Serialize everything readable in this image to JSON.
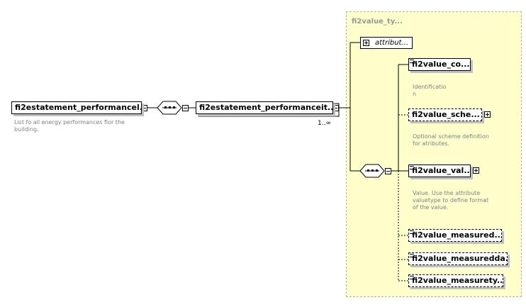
{
  "type_box": {
    "title": "fi2value_ty..."
  },
  "attributes": {
    "label": "attribut..."
  },
  "root": {
    "label": "fi2estatement_performancel...",
    "doc": [
      "List fo all energy performances fior the",
      "building."
    ]
  },
  "child": {
    "label": "fi2estatement_performanceit...",
    "cardinality": "1..∞"
  },
  "elements": [
    {
      "label": "fi2value_co...",
      "doc": [
        "Identificatio",
        "n"
      ]
    },
    {
      "label": "fi2value_sche...",
      "doc": [
        "Optional scheme definition",
        "for atributes."
      ]
    },
    {
      "label": "fi2value_val...",
      "doc": [
        "Value. Use the attribute",
        "valuetype to define format",
        "of the value."
      ]
    },
    {
      "label": "fi2value_measured..."
    },
    {
      "label": "fi2value_measuredda..."
    },
    {
      "label": "fi2value_measurety..."
    }
  ]
}
